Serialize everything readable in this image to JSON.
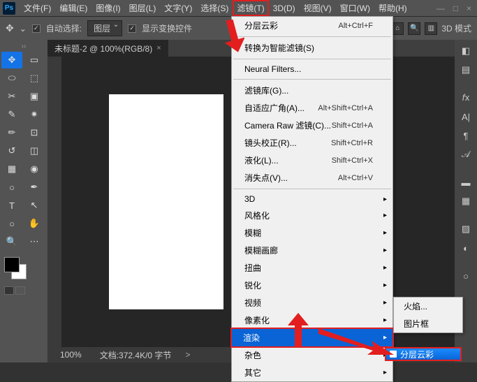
{
  "app": {
    "logo": "Ps"
  },
  "menubar": {
    "items": [
      "文件(F)",
      "编辑(E)",
      "图像(I)",
      "图层(L)",
      "文字(Y)",
      "选择(S)",
      "滤镜(T)",
      "3D(D)",
      "视图(V)",
      "窗口(W)",
      "帮助(H)"
    ],
    "active_index": 6
  },
  "optionsbar": {
    "autosel_label": "自动选择:",
    "layer_dropdown": "图层",
    "show_transform": "显示变换控件",
    "mode_3d": "3D 模式"
  },
  "document": {
    "tab_title": "未标题-2 @ 100%(RGB/8)",
    "tab_close": "×"
  },
  "statusbar": {
    "zoom": "100%",
    "fileinfo": "文档:372.4K/0 字节",
    "arrowchar": ">"
  },
  "filter_menu": {
    "last_filter": {
      "label": "分层云彩",
      "shortcut": "Alt+Ctrl+F"
    },
    "convert_smart": "转换为智能滤镜(S)",
    "neural": "Neural Filters...",
    "gallery": "滤镜库(G)...",
    "adaptive": {
      "label": "自适应广角(A)...",
      "shortcut": "Alt+Shift+Ctrl+A"
    },
    "camera_raw": {
      "label": "Camera Raw 滤镜(C)...",
      "shortcut": "Shift+Ctrl+A"
    },
    "lens": {
      "label": "镜头校正(R)...",
      "shortcut": "Shift+Ctrl+R"
    },
    "liquify": {
      "label": "液化(L)...",
      "shortcut": "Shift+Ctrl+X"
    },
    "vanishing": {
      "label": "消失点(V)...",
      "shortcut": "Alt+Ctrl+V"
    },
    "submenus": [
      "3D",
      "风格化",
      "模糊",
      "模糊画廊",
      "扭曲",
      "锐化",
      "视频",
      "像素化",
      "渲染",
      "杂色",
      "其它"
    ],
    "highlighted_index": 8
  },
  "render_submenu": {
    "items": [
      "火焰...",
      "图片框"
    ]
  },
  "final_button": {
    "label": "分层云彩"
  },
  "colors": {
    "accent": "#0a64d6",
    "annot": "#e31e1e"
  }
}
